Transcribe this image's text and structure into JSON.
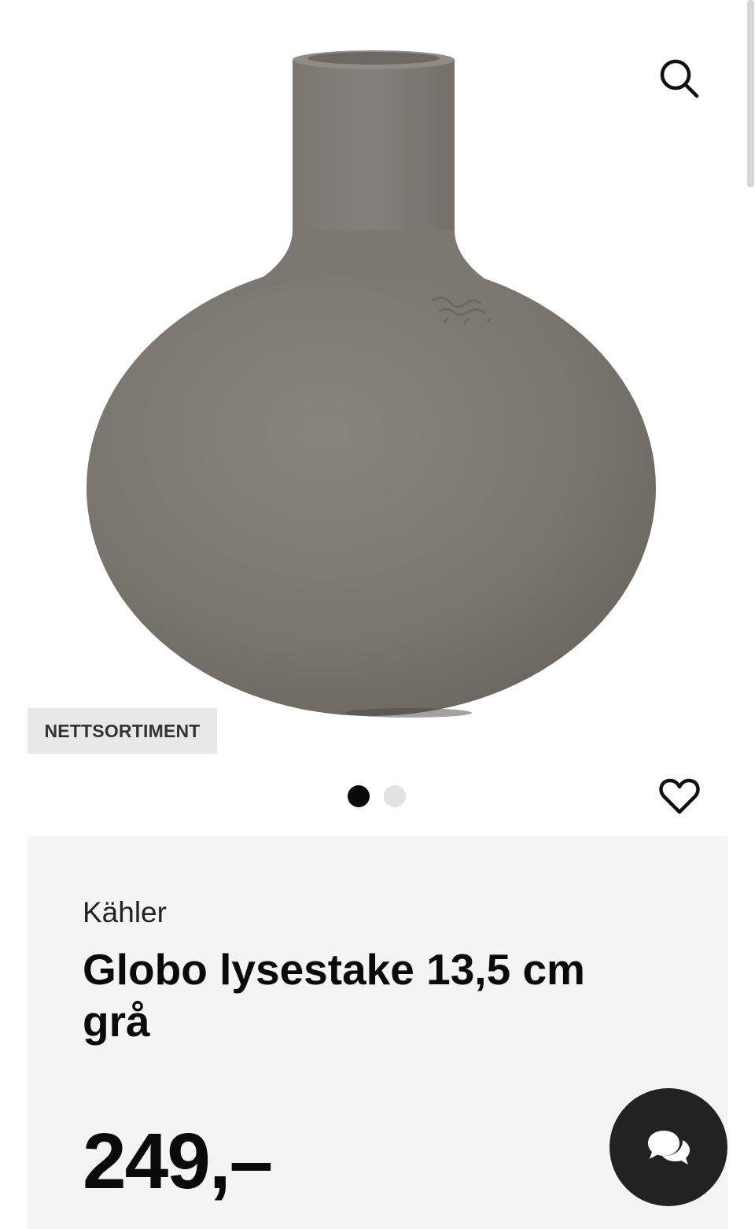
{
  "header": {
    "search_icon": "search-icon"
  },
  "product_image": {
    "slide_count": 2,
    "active_slide": 1,
    "object_color": "#7d7772"
  },
  "badge": {
    "label": "NETTSORTIMENT"
  },
  "favorite_icon": "heart-outline-icon",
  "product": {
    "brand": "Kähler",
    "name": "Globo lysestake 13,5 cm grå",
    "price": "249,–"
  },
  "chat": {
    "icon": "chat-bubbles-icon",
    "color": "#222222"
  }
}
